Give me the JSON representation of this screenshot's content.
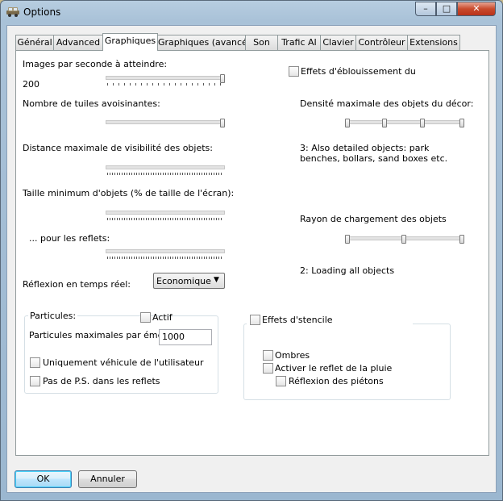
{
  "window": {
    "title": "Options"
  },
  "caption": {
    "minimize": "–",
    "maximize": "□",
    "close": "✕"
  },
  "tabs": [
    {
      "label": "Général"
    },
    {
      "label": "Advanced"
    },
    {
      "label": "Graphiques",
      "active": true
    },
    {
      "label": "Graphiques (avancé)"
    },
    {
      "label": "Son"
    },
    {
      "label": "Trafic AI"
    },
    {
      "label": "Clavier"
    },
    {
      "label": "Contrôleur"
    },
    {
      "label": "Extensions"
    }
  ],
  "left": {
    "fps_label": "Images par seconde à atteindre:",
    "fps_value": "200",
    "fps_level": 1.0,
    "tiles_label": "Nombre de tuiles avoisinantes:",
    "tiles_level": 1.0,
    "visibility_label": "Distance maximale de visibilité des objets:",
    "visibility_level": 0.0,
    "min_size_label": "Taille minimum d'objets (% de taille de l'écran):",
    "min_size_level": 0.0,
    "reflections_label": "... pour les reflets:",
    "reflections_level": 0.0,
    "realtime_label": "Réflexion en temps réel:",
    "realtime_value": "Economique",
    "realtime_arrow": "▼"
  },
  "particles": {
    "group_label": "Particules:",
    "active_label": "Actif",
    "active_checked": false,
    "max_label": "Particules maximales par émetteur:",
    "max_value": "1000",
    "user_vehicle_label": "Uniquement véhicule de l'utilisateur",
    "user_vehicle_checked": false,
    "no_ps_label": "Pas de P.S. dans les reflets",
    "no_ps_checked": false
  },
  "right": {
    "glare_label": "Effets d'éblouissement du",
    "glare_checked": false,
    "density_label": "Densité maximale des objets du décor:",
    "density_level": 1.0,
    "density_value": "3: Also detailed objects: park benches, bollars, sand boxes etc.",
    "radius_label": "Rayon de chargement des objets",
    "radius_level": 1.0,
    "radius_value": "2: Loading all objects"
  },
  "stencil": {
    "group_label": "Effets d'stencile",
    "group_checked": false,
    "shadows_label": "Ombres",
    "shadows_checked": false,
    "rain_label": "Activer le reflet de la pluie",
    "rain_checked": false,
    "pedestrians_label": "Réflexion des piétons",
    "pedestrians_checked": false
  },
  "buttons": {
    "ok": "OK",
    "cancel": "Annuler"
  }
}
